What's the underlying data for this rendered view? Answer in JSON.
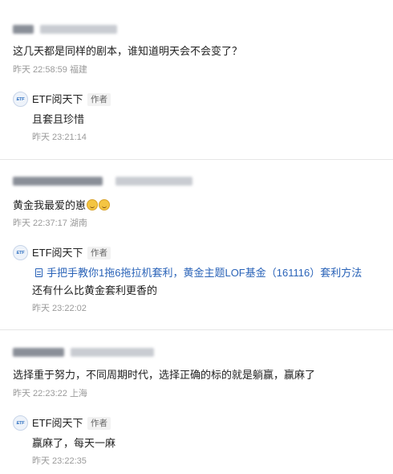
{
  "comments": [
    {
      "user_name": "●●●●",
      "user_meta": "●●●●●●●●",
      "text": "这几天都是同样的剧本，谁知道明天会不会变了？",
      "time": "昨天 22:58:59",
      "location": "福建",
      "reply": {
        "author": "ETF阅天下",
        "badge": "作者",
        "text": "且套且珍惜",
        "time": "昨天 23:21:14"
      }
    },
    {
      "user_name": "●●●●●●●●●",
      "user_meta": "●●●●●●●●●●",
      "text": "黄金我最爱的崽",
      "time": "昨天 22:37:17",
      "location": "湖南",
      "reply": {
        "author": "ETF阅天下",
        "badge": "作者",
        "link_text": "手把手教你1拖6拖拉机套利，黄金主题LOF基金（161116）套利方法",
        "text": "还有什么比黄金套利更香的",
        "time": "昨天 23:22:02"
      }
    },
    {
      "user_name": "●●●●●",
      "user_meta": "●●●●●●●●●●",
      "text": "选择重于努力，不同周期时代，选择正确的标的就是躺赢，赢麻了",
      "time": "昨天 22:23:22",
      "location": "上海",
      "reply": {
        "author": "ETF阅天下",
        "badge": "作者",
        "text": "赢麻了，每天一麻",
        "time": "昨天 23:22:35"
      }
    }
  ],
  "avatar_text": "ETF",
  "colors": {
    "link": "#2a63b8",
    "meta": "#9a9a9a",
    "divider": "#e6e6e6"
  },
  "icons": [
    "document-icon",
    "emoji-icon"
  ]
}
